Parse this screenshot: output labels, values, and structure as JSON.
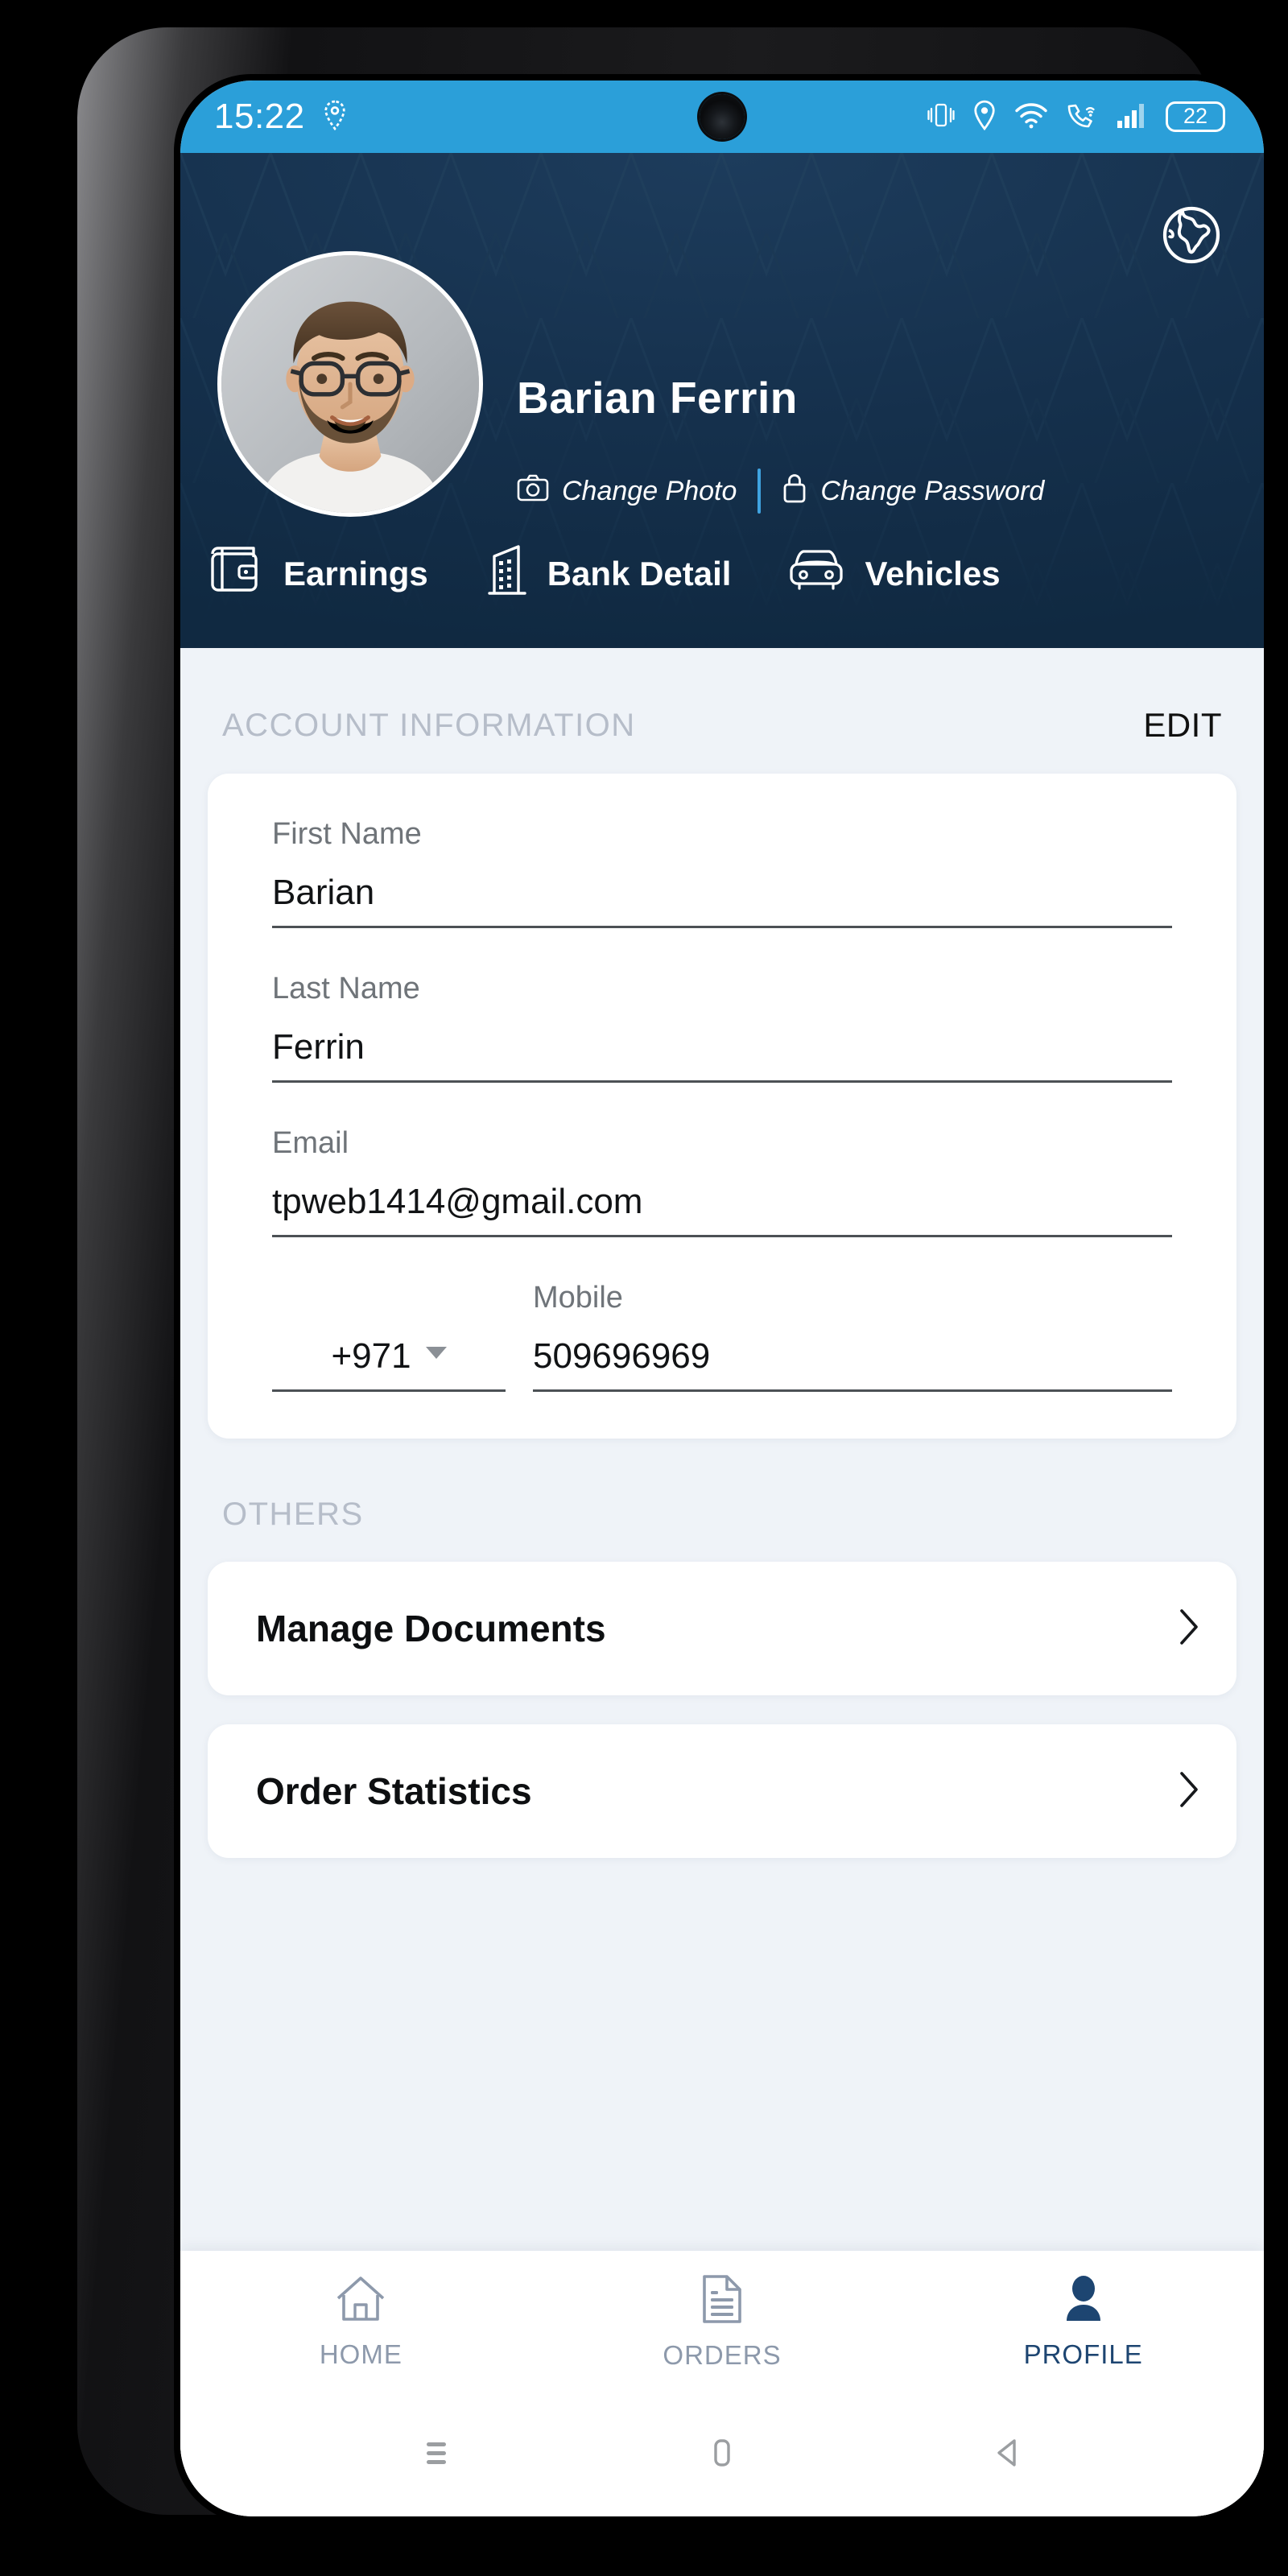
{
  "status_bar": {
    "time": "15:22",
    "icons_left": [
      "location-pin-icon"
    ],
    "icons_right": [
      "vibrate-icon",
      "location-pin-icon",
      "wifi-icon",
      "wifi-calling-icon",
      "signal-bars-icon"
    ],
    "battery_level": "22",
    "background_color": "#2b9fd9"
  },
  "header": {
    "background_color": "#15304c",
    "user_name": "Barian Ferrin",
    "globe_icon": "globe-icon",
    "avatar": "user-avatar-photo",
    "change_photo_label": "Change Photo",
    "change_photo_icon": "camera-icon",
    "change_password_label": "Change Password",
    "change_password_icon": "lock-icon",
    "tabs": [
      {
        "label": "Earnings",
        "icon": "wallet-icon"
      },
      {
        "label": "Bank Detail",
        "icon": "bank-building-icon"
      },
      {
        "label": "Vehicles",
        "icon": "car-icon"
      }
    ]
  },
  "account_section": {
    "title": "ACCOUNT INFORMATION",
    "edit_label": "EDIT",
    "fields": [
      {
        "label": "First Name",
        "value": "Barian"
      },
      {
        "label": "Last Name",
        "value": "Ferrin"
      },
      {
        "label": "Email",
        "value": "tpweb1414@gmail.com"
      }
    ],
    "mobile": {
      "label": "Mobile",
      "country_code": "+971",
      "number": "509696969"
    }
  },
  "others_section": {
    "title": "OTHERS",
    "rows": [
      {
        "label": "Manage Documents",
        "chevron": "chevron-right-icon"
      },
      {
        "label": "Order Statistics",
        "chevron": "chevron-right-icon"
      }
    ]
  },
  "bottom_nav": {
    "active_color": "#1d4571",
    "inactive_color": "#8d99ab",
    "items": [
      {
        "label": "HOME",
        "icon": "home-icon",
        "active": false
      },
      {
        "label": "ORDERS",
        "icon": "document-icon",
        "active": false
      },
      {
        "label": "PROFILE",
        "icon": "person-icon",
        "active": true
      }
    ]
  },
  "system_nav": {
    "items": [
      {
        "name": "recents-icon"
      },
      {
        "name": "home-square-icon"
      },
      {
        "name": "back-triangle-icon"
      }
    ]
  }
}
